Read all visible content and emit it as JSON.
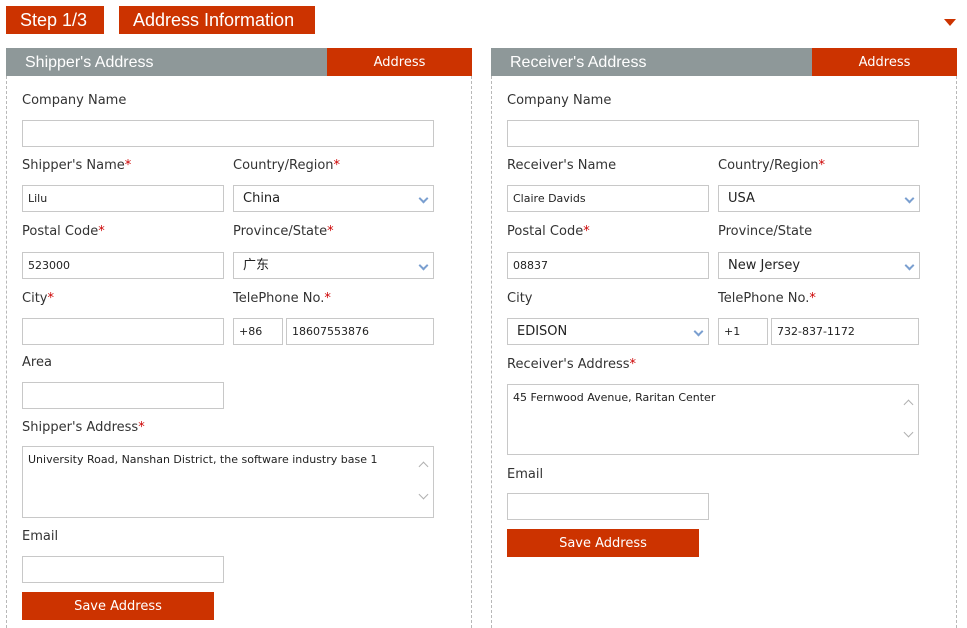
{
  "header": {
    "step_label": "Step 1/3",
    "title": "Address Information",
    "collapse_icon": "triangle-down-icon"
  },
  "colors": {
    "accent": "#cc3300",
    "panel_header": "#8e9899",
    "required": "#cc0000"
  },
  "shipper": {
    "title": "Shipper's Address",
    "tab_label": "Address",
    "company_label": "Company Name",
    "company_value": "",
    "name_label": "Shipper's Name",
    "name_value": "Lilu",
    "country_label": "Country/Region",
    "country_value": "China",
    "postal_label": "Postal Code",
    "postal_value": "523000",
    "province_label": "Province/State",
    "province_value": "广东",
    "city_label": "City",
    "city_value": "",
    "phone_label": "TelePhone No.",
    "phone_code": "+86",
    "phone_value": "18607553876",
    "area_label": "Area",
    "area_value": "",
    "address_label": "Shipper's Address",
    "address_value": "University Road, Nanshan District, the software industry base 1",
    "email_label": "Email",
    "email_value": "",
    "save_label": "Save Address",
    "required_mark": "*"
  },
  "receiver": {
    "title": "Receiver's Address",
    "tab_label": "Address",
    "company_label": "Company Name",
    "company_value": "",
    "name_label": "Receiver's Name",
    "name_value": "Claire Davids",
    "country_label": "Country/Region",
    "country_value": "USA",
    "postal_label": "Postal Code",
    "postal_value": "08837",
    "province_label": "Province/State",
    "province_value": "New Jersey",
    "city_label": "City",
    "city_value": "EDISON",
    "phone_label": "TelePhone No.",
    "phone_code": "+1",
    "phone_value": "732-837-1172",
    "address_label": "Receiver's Address",
    "address_value": "45 Fernwood Avenue, Raritan Center",
    "email_label": "Email",
    "email_value": "",
    "save_label": "Save Address",
    "required_mark": "*"
  }
}
